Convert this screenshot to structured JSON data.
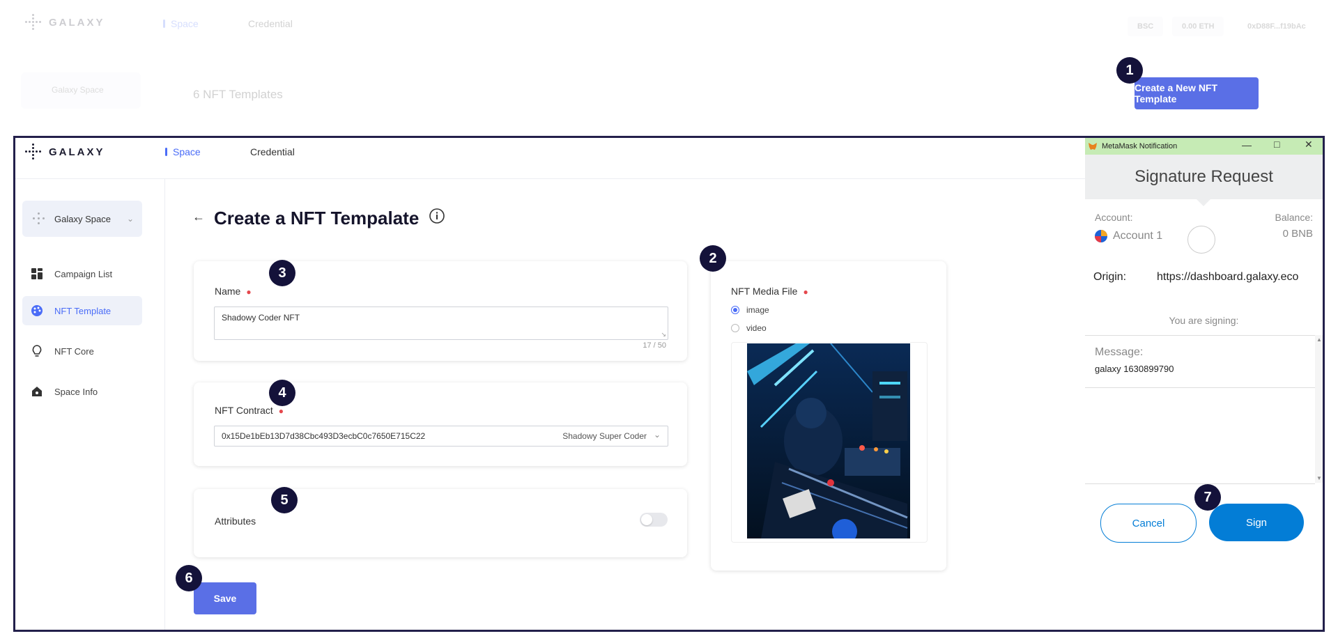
{
  "app": {
    "logo_text": "GALAXY",
    "nav": [
      {
        "label": "Space"
      },
      {
        "label": "Credential"
      }
    ]
  },
  "background_page": {
    "network": "BSC",
    "balance": "0.00 ETH",
    "address": "0xD88F...f19bAc",
    "space_name": "Galaxy Space",
    "template_count": "6 NFT Templates",
    "create_button": "Create a New NFT Template"
  },
  "badges": [
    "1",
    "2",
    "3",
    "4",
    "5",
    "6",
    "7"
  ],
  "sidebar": {
    "space_selector": "Galaxy Space",
    "items": [
      {
        "label": "Campaign List",
        "icon": "grid-icon"
      },
      {
        "label": "NFT Template",
        "icon": "palette-icon"
      },
      {
        "label": "NFT Core",
        "icon": "bulb-icon"
      },
      {
        "label": "Space Info",
        "icon": "home-icon"
      }
    ]
  },
  "form": {
    "title": "Create a NFT Tempalate",
    "name_label": "Name",
    "name_value": "Shadowy Coder NFT",
    "name_counter": "17 / 50",
    "contract_label": "NFT Contract",
    "contract_value": "0x15De1bEb13D7d38Cbc493D3ecbC0c7650E715C22",
    "contract_name": "Shadowy Super Coder",
    "attributes_label": "Attributes",
    "attributes_enabled": false,
    "media_label": "NFT Media File",
    "media_options": [
      "image",
      "video"
    ],
    "media_selected": "image",
    "save_label": "Save"
  },
  "metamask": {
    "window_title": "MetaMask Notification",
    "header": "Signature Request",
    "account_label": "Account:",
    "account_name": "Account 1",
    "balance_label": "Balance:",
    "balance_value": "0 BNB",
    "origin_label": "Origin:",
    "origin_value": "https://dashboard.galaxy.eco",
    "signing_label": "You are signing:",
    "message_label": "Message:",
    "message_value": "galaxy 1630899790",
    "cancel_label": "Cancel",
    "sign_label": "Sign"
  },
  "colors": {
    "accent": "#5a6fe6",
    "metamask_blue": "#037dd6",
    "badge": "#14123a",
    "frame_border": "#23204b"
  }
}
